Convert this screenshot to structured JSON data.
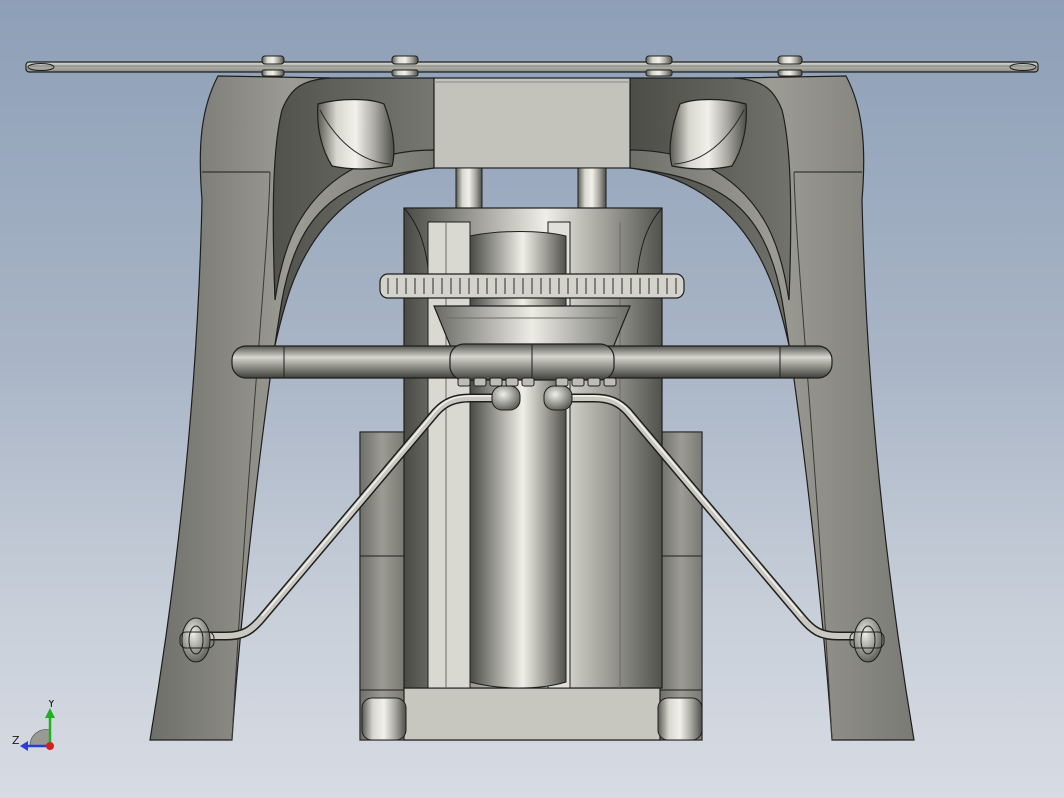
{
  "triad": {
    "y_label": "Y",
    "z_label": "Z"
  },
  "colors": {
    "background_top": "#8d9fb7",
    "background_bottom": "#d7dbe3",
    "part_gray": "#8f8f89",
    "part_light": "#c9c9c1",
    "part_dark": "#55554f",
    "edge": "#1e1e1e",
    "axis_y": "#22b022",
    "axis_z": "#2a3fd6",
    "axis_x": "#d42020"
  }
}
